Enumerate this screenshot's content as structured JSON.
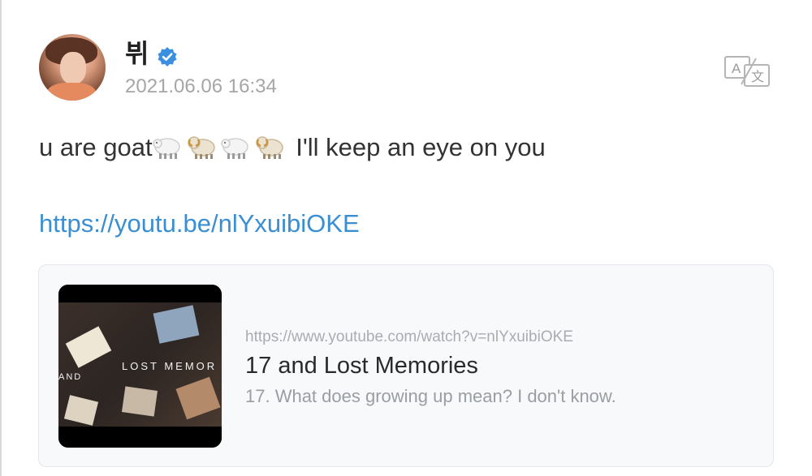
{
  "author": {
    "name": "뷔",
    "verified": true,
    "timestamp": "2021.06.06 16:34"
  },
  "post": {
    "text_before": "u are goat",
    "emojis": [
      "sheep-emoji",
      "ram-emoji",
      "sheep-emoji",
      "ram-emoji"
    ],
    "text_after": " I'll keep an eye on you",
    "link": "https://youtu.be/nlYxuibiOKE"
  },
  "link_card": {
    "url": "https://www.youtube.com/watch?v=nlYxuibiOKE",
    "title": "17 and Lost Memories",
    "description": "17. What does growing up mean? I don't know.",
    "thumbnail_text": "LOST MEMOR",
    "thumbnail_text_left": "AND"
  },
  "icons": {
    "verified": "verified-badge-icon",
    "translate": "translate-icon"
  },
  "colors": {
    "verified_blue": "#3b8fe0",
    "link_blue": "#3a8fd3",
    "timestamp_gray": "#a6a6a6"
  }
}
